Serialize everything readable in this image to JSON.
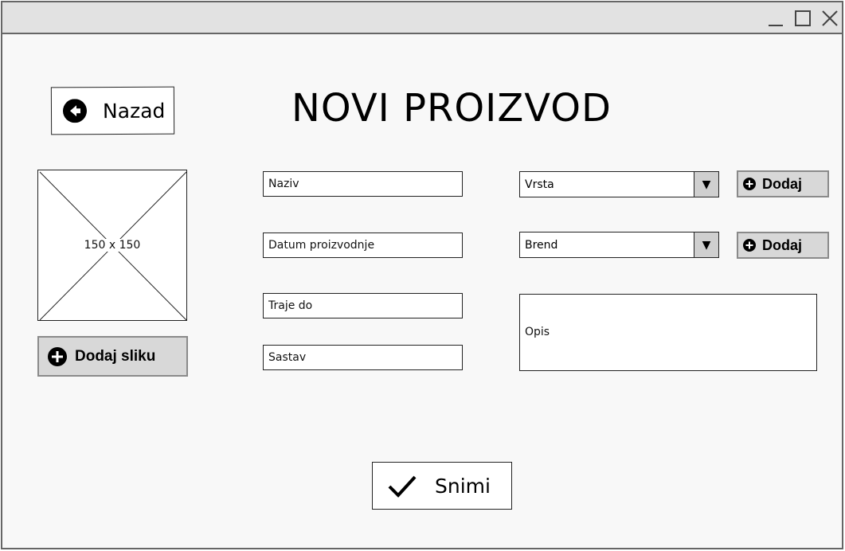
{
  "window": {
    "controls": [
      "minimize-icon",
      "maximize-icon",
      "close-icon"
    ]
  },
  "header": {
    "back_label": "Nazad",
    "title": "NOVI PROIZVOD"
  },
  "image": {
    "placeholder_text": "150 x 150",
    "add_image_label": "Dodaj sliku"
  },
  "form": {
    "naziv_placeholder": "Naziv",
    "datum_placeholder": "Datum proizvodnje",
    "traje_placeholder": "Traje do",
    "sastav_placeholder": "Sastav",
    "vrsta_value": "Vrsta",
    "brend_value": "Brend",
    "add_label": "Dodaj",
    "opis_placeholder": "Opis",
    "dropdown_arrow": "▼"
  },
  "footer": {
    "save_label": "Snimi"
  },
  "colors": {
    "window_bg": "#f8f8f8",
    "titlebar_bg": "#e2e2e2",
    "button_gray": "#d8d8d8",
    "border": "#222222"
  }
}
